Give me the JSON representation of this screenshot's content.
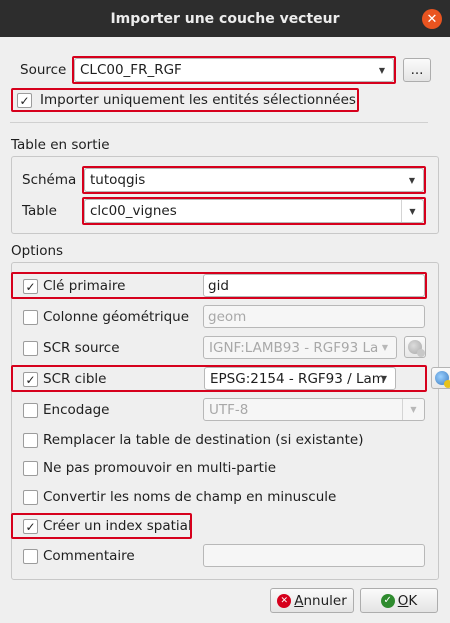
{
  "window": {
    "title": "Importer une couche vecteur",
    "close_symbol": "✕"
  },
  "source": {
    "label": "Source",
    "value": "CLC00_FR_RGF",
    "browse_label": "..."
  },
  "import_selected": {
    "label": "Importer uniquement les entités sélectionnées",
    "checked": true
  },
  "output_table": {
    "title": "Table en sortie",
    "schema_label": "Schéma",
    "schema_value": "tutoqgis",
    "table_label": "Table",
    "table_value": "clc00_vignes"
  },
  "options": {
    "title": "Options",
    "primary_key": {
      "label": "Clé primaire",
      "value": "gid",
      "checked": true
    },
    "geometry_column": {
      "label": "Colonne géométrique",
      "value": "geom",
      "checked": false
    },
    "source_crs": {
      "label": "SCR source",
      "value": "IGNF:LAMB93 - RGF93 La",
      "checked": false
    },
    "target_crs": {
      "label": "SCR cible",
      "value": "EPSG:2154 - RGF93 / Lam",
      "checked": true
    },
    "encoding": {
      "label": "Encodage",
      "value": "UTF-8",
      "checked": false
    },
    "replace_table": {
      "label": "Remplacer la table de destination (si existante)",
      "checked": false
    },
    "no_multipart": {
      "label": "Ne pas promouvoir en multi-partie",
      "checked": false
    },
    "lowercase_fields": {
      "label": "Convertir les noms de champ en minuscule",
      "checked": false
    },
    "spatial_index": {
      "label": "Créer un index spatial",
      "checked": true
    },
    "comment": {
      "label": "Commentaire",
      "value": "",
      "checked": false
    }
  },
  "buttons": {
    "cancel_prefix": "A",
    "cancel_rest": "nnuler",
    "ok_prefix": "O",
    "ok_rest": "K"
  },
  "colors": {
    "highlight": "#d6001c",
    "titlebar": "#2d2d2d",
    "close": "#e95420"
  }
}
